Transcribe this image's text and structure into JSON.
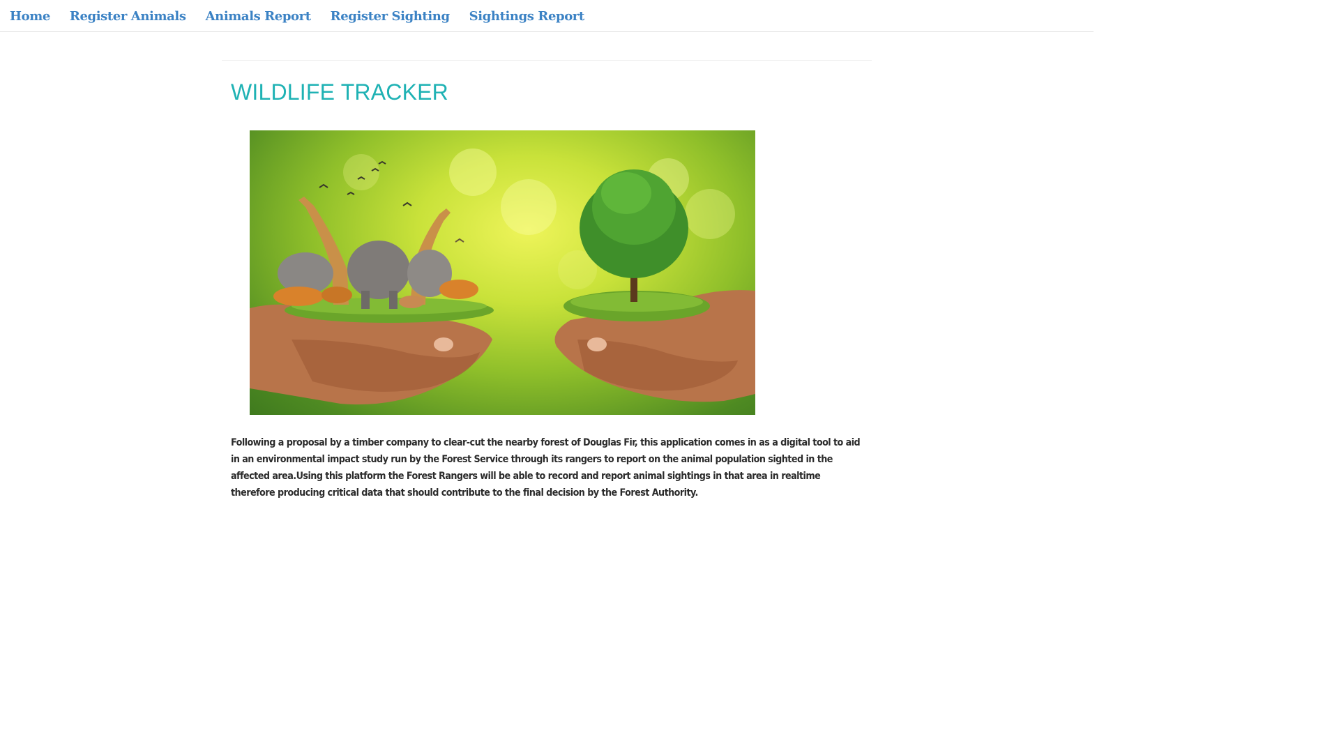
{
  "nav": {
    "items": [
      {
        "label": "Home"
      },
      {
        "label": "Register Animals"
      },
      {
        "label": "Animals Report"
      },
      {
        "label": "Register Sighting"
      },
      {
        "label": "Sightings Report"
      }
    ]
  },
  "main": {
    "title": "WILDLIFE TRACKER",
    "description": "Following a proposal by a timber company to clear-cut the nearby forest of Douglas Fir, this application comes in as a digital tool to aid in an environmental impact study run by the Forest Service through its rangers to report on the animal population sighted in the affected area.Using this platform the Forest Rangers will be able to record and report animal sightings in that area in realtime therefore producing critical data that should contribute to the final decision by the Forest Authority."
  },
  "colors": {
    "nav_link": "#3b82c4",
    "title": "#1fb2b4",
    "body_text": "#2b2b2b"
  }
}
